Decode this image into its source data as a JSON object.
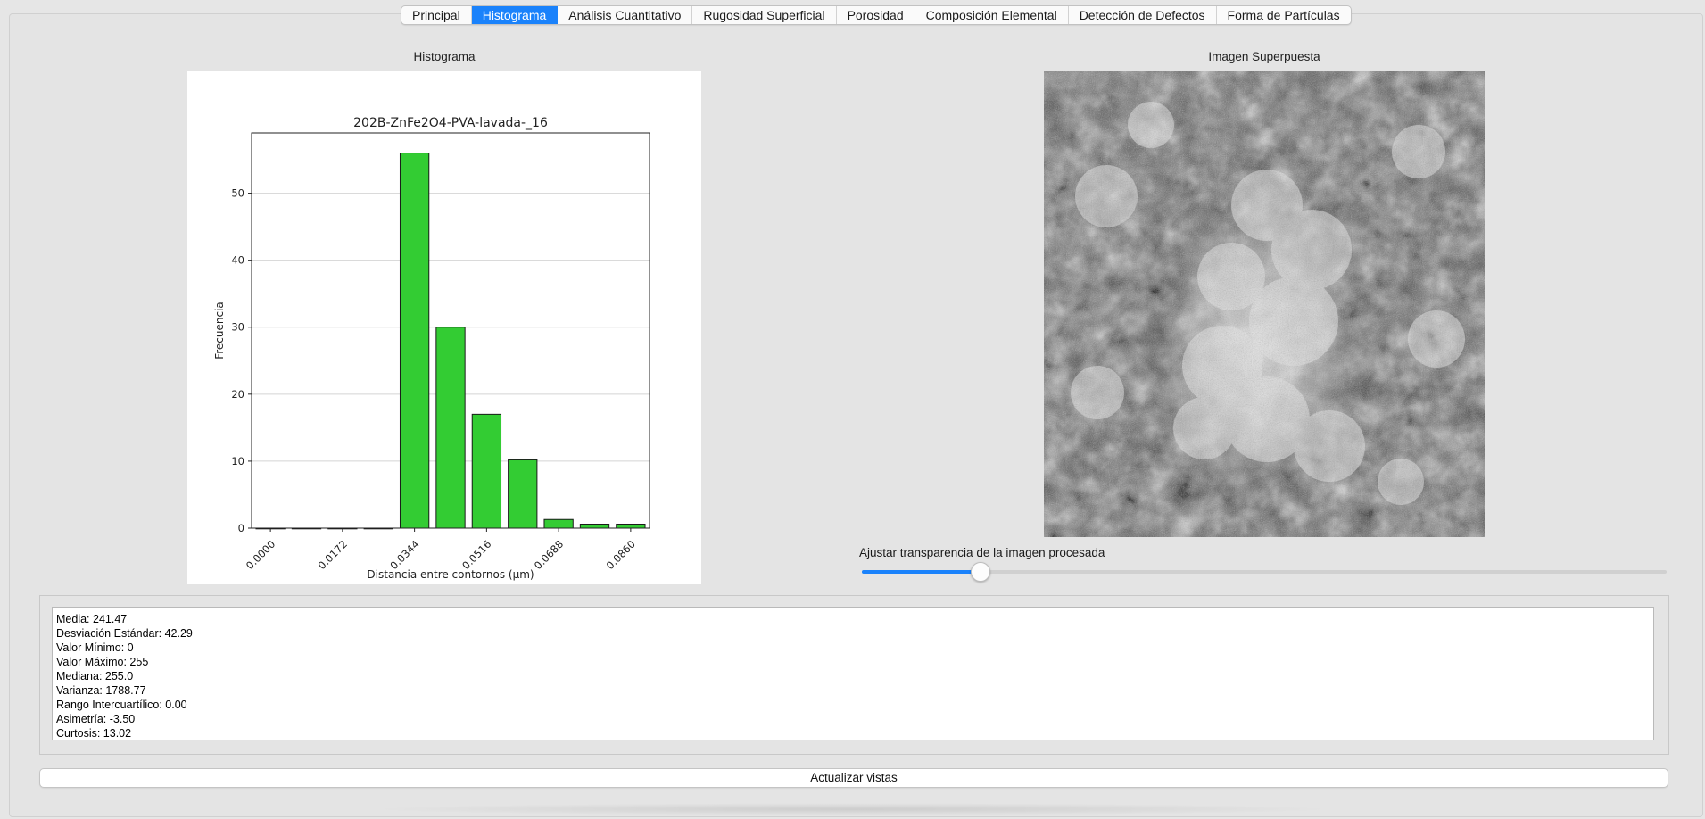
{
  "tabs": [
    {
      "label": "Principal",
      "active": false
    },
    {
      "label": "Histograma",
      "active": true
    },
    {
      "label": "Análisis Cuantitativo",
      "active": false
    },
    {
      "label": "Rugosidad Superficial",
      "active": false
    },
    {
      "label": "Porosidad",
      "active": false
    },
    {
      "label": "Composición Elemental",
      "active": false
    },
    {
      "label": "Detección de Defectos",
      "active": false
    },
    {
      "label": "Forma de Partículas",
      "active": false
    }
  ],
  "histogram_panel": {
    "title": "Histograma"
  },
  "overlay_panel": {
    "title": "Imagen Superpuesta"
  },
  "slider": {
    "label": "Ajustar transparencia de la imagen procesada",
    "value_fraction": 0.146
  },
  "stats": [
    "Media: 241.47",
    "Desviación Estándar: 42.29",
    "Valor Mínimo: 0",
    "Valor Máximo: 255",
    "Mediana: 255.0",
    "Varianza: 1788.77",
    "Rango Intercuartílico: 0.00",
    "Asimetría: -3.50",
    "Curtosis: 13.02"
  ],
  "refresh_button": {
    "label": "Actualizar vistas"
  },
  "colors": {
    "accent": "#1a82fb",
    "bar_fill": "#33cc33",
    "bar_edge": "#1a1a1a"
  },
  "chart_data": {
    "type": "bar",
    "title": "202B-ZnFe2O4-PVA-lavada-_16",
    "xlabel": "Distancia entre contornos (µm)",
    "ylabel": "Frecuencia",
    "x": [
      0.0,
      0.0086,
      0.0172,
      0.0258,
      0.0344,
      0.043,
      0.0516,
      0.0602,
      0.0688,
      0.0774,
      0.086
    ],
    "values": [
      0,
      0,
      0,
      0,
      56,
      30,
      17,
      10.2,
      1.3,
      0.6,
      0.6
    ],
    "xticks": [
      "0.0000",
      "0.0172",
      "0.0344",
      "0.0516",
      "0.0688",
      "0.0860"
    ],
    "xtick_values": [
      0.0,
      0.0172,
      0.0344,
      0.0516,
      0.0688,
      0.086
    ],
    "yticks": [
      0,
      10,
      20,
      30,
      40,
      50
    ],
    "xlim": [
      -0.0045,
      0.0905
    ],
    "ylim": [
      0,
      59
    ],
    "grid": "y"
  }
}
